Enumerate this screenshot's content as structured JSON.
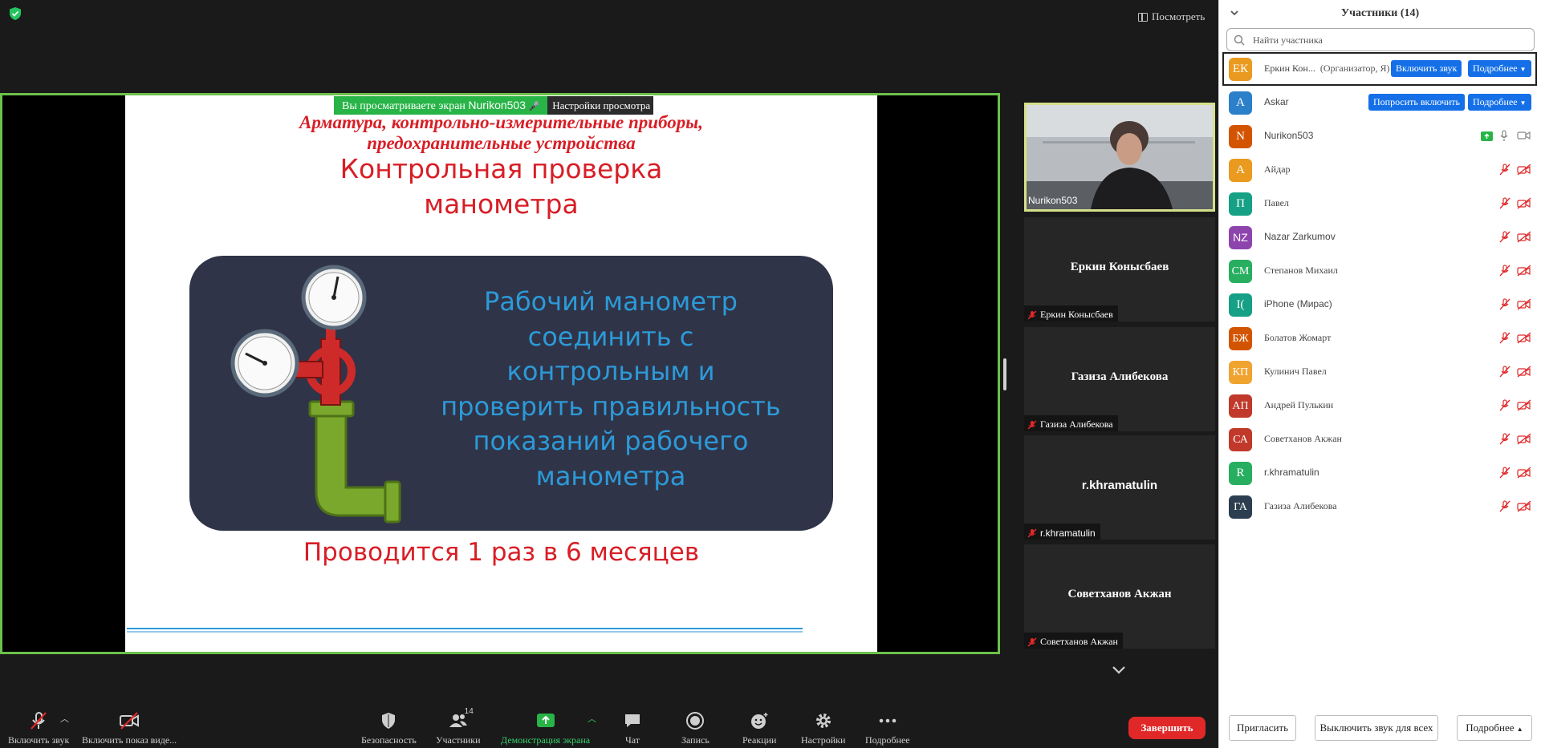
{
  "header": {
    "view_label": "Посмотреть"
  },
  "share": {
    "banner_text": "Вы просматриваете экран",
    "banner_name": "Nurikon503",
    "settings_label": "Настройки просмотра"
  },
  "slide": {
    "title_line1": "Арматура, контрольно-измерительные приборы,",
    "title_line2": "предохранительные устройства",
    "heading_line1": "Контрольная проверка",
    "heading_line2": "манометра",
    "box_lines": [
      "Рабочий манометр",
      "соединить с",
      "контрольным и",
      "проверить правильность",
      "показаний рабочего",
      "манометра"
    ],
    "footer": "Проводится 1 раз в 6 месяцев"
  },
  "gallery": {
    "video_tile": {
      "label": "Nurikon503"
    },
    "tiles": [
      {
        "name": "Еркин Конысбаев",
        "label": "Еркин Конысбаев"
      },
      {
        "name": "Газиза Алибекова",
        "label": "Газиза Алибекова"
      },
      {
        "name": "r.khramatulin",
        "label": "r.khramatulin"
      },
      {
        "name": "Советханов Акжан",
        "label": "Советханов Акжан"
      }
    ]
  },
  "toolbar": {
    "unmute": "Включить звук",
    "start_video": "Включить показ виде...",
    "security": "Безопасность",
    "participants": "Участники",
    "participants_count": "14",
    "share_screen": "Демонстрация экрана",
    "chat": "Чат",
    "record": "Запись",
    "reactions": "Реакции",
    "settings": "Настройки",
    "more": "Подробнее",
    "end": "Завершить"
  },
  "panel": {
    "title": "Участники (14)",
    "search_placeholder": "Найти участника",
    "participants": [
      {
        "initials": "ЕК",
        "name": "Еркин Кон...",
        "role": "(Организатор, Я)",
        "color": "#e99a1f"
      },
      {
        "initials": "A",
        "name": "Askar",
        "color": "#2c7fc9"
      },
      {
        "initials": "N",
        "name": "Nurikon503",
        "color": "#d35400"
      },
      {
        "initials": "А",
        "name": "Айдар",
        "color": "#e99a1f"
      },
      {
        "initials": "П",
        "name": "Павел",
        "color": "#16a085"
      },
      {
        "initials": "NZ",
        "name": "Nazar Zarkumov",
        "color": "#8e44ad"
      },
      {
        "initials": "СМ",
        "name": "Степанов Михаил",
        "color": "#27ae60"
      },
      {
        "initials": "I(",
        "name": "iPhone (Мирас)",
        "color": "#16a085"
      },
      {
        "initials": "БЖ",
        "name": "Болатов Жомарт",
        "color": "#d35400"
      },
      {
        "initials": "КП",
        "name": "Кулинич Павел",
        "color": "#f0a32f"
      },
      {
        "initials": "АП",
        "name": "Андрей Пулькин",
        "color": "#c0392b"
      },
      {
        "initials": "СА",
        "name": "Советханов Акжан",
        "color": "#c0392b"
      },
      {
        "initials": "R",
        "name": "r.khramatulin",
        "color": "#27ae60"
      },
      {
        "initials": "ГА",
        "name": "Газиза Алибекова",
        "color": "#2c3e50"
      }
    ],
    "unmute_btn": "Включить звук",
    "ask_unmute_btn": "Попросить включить",
    "more_btn": "Подробнее",
    "invite": "Пригласить",
    "mute_all": "Выключить звук для всех",
    "footer_more": "Подробнее"
  },
  "colors": {
    "share_border": "#6cc14a",
    "accent_blue": "#1570e8",
    "end_red": "#e02828",
    "slide_red": "#d81e26",
    "slide_blue_text": "#2c9ad8"
  }
}
